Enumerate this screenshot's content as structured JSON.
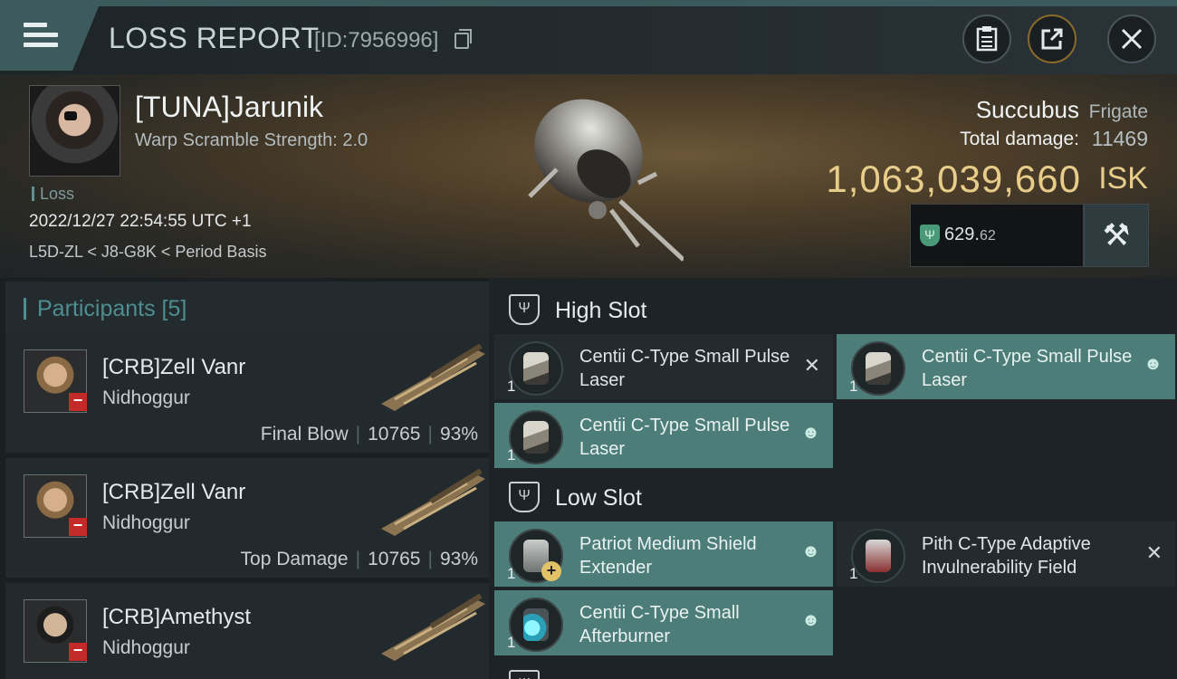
{
  "header": {
    "title": "LOSS REPORT",
    "report_id": "[ID:7956996]",
    "buttons": {
      "menu": "menu-icon",
      "clipboard": "clipboard-icon",
      "share": "share-icon",
      "close": "close-icon"
    }
  },
  "victim": {
    "name": "[TUNA]Jarunik",
    "warp_scramble": "Warp Scramble Strength: 2.0",
    "status": "Loss",
    "datetime": "2022/12/27 22:54:55 UTC +1",
    "location": "L5D-ZL < J8-G8K < Period Basis",
    "ship_name": "Succubus",
    "ship_class": "Frigate",
    "total_damage_label": "Total damage:",
    "total_damage": "11469",
    "isk_value": "1,063,039,660",
    "isk_unit": "ISK",
    "fit_value_main": "629.",
    "fit_value_decimal": "62",
    "fit_icon_glyph": "Ψ",
    "tools_icon_glyph": "⚒"
  },
  "participants": {
    "title": "Participants [5]",
    "rows": [
      {
        "name": "[CRB]Zell Vanr",
        "ship": "Nidhoggur",
        "tag": "Final Blow",
        "damage": "10765",
        "percent": "93%"
      },
      {
        "name": "[CRB]Zell Vanr",
        "ship": "Nidhoggur",
        "tag": "Top Damage",
        "damage": "10765",
        "percent": "93%"
      },
      {
        "name": "[CRB]Amethyst",
        "ship": "Nidhoggur",
        "tag": "",
        "damage": "",
        "percent": ""
      }
    ]
  },
  "modules": {
    "high_slot_label": "High Slot",
    "low_slot_label": "Low Slot",
    "slot_glyph": "Ψ",
    "high": [
      {
        "name": "Centii C-Type Small Pulse Laser",
        "qty": "1",
        "status": "destroyed",
        "status_glyph": "✕"
      },
      {
        "name": "Centii C-Type Small Pulse Laser",
        "qty": "1",
        "status": "dropped",
        "status_glyph": "☻"
      },
      {
        "name": "Centii C-Type Small Pulse Laser",
        "qty": "1",
        "status": "dropped",
        "status_glyph": "☻"
      }
    ],
    "low": [
      {
        "name": "Patriot Medium Shield Extender",
        "qty": "1",
        "status": "dropped",
        "status_glyph": "☻"
      },
      {
        "name": "Pith C-Type Adaptive Invulnerability Field",
        "qty": "1",
        "status": "destroyed",
        "status_glyph": "✕"
      },
      {
        "name": "Centii C-Type Small Afterburner",
        "qty": "1",
        "status": "dropped",
        "status_glyph": "☻"
      }
    ]
  },
  "colors": {
    "accent_teal": "#4d7d78",
    "isk_gold": "#e8cc8a",
    "loss_red": "#c42a2a"
  }
}
